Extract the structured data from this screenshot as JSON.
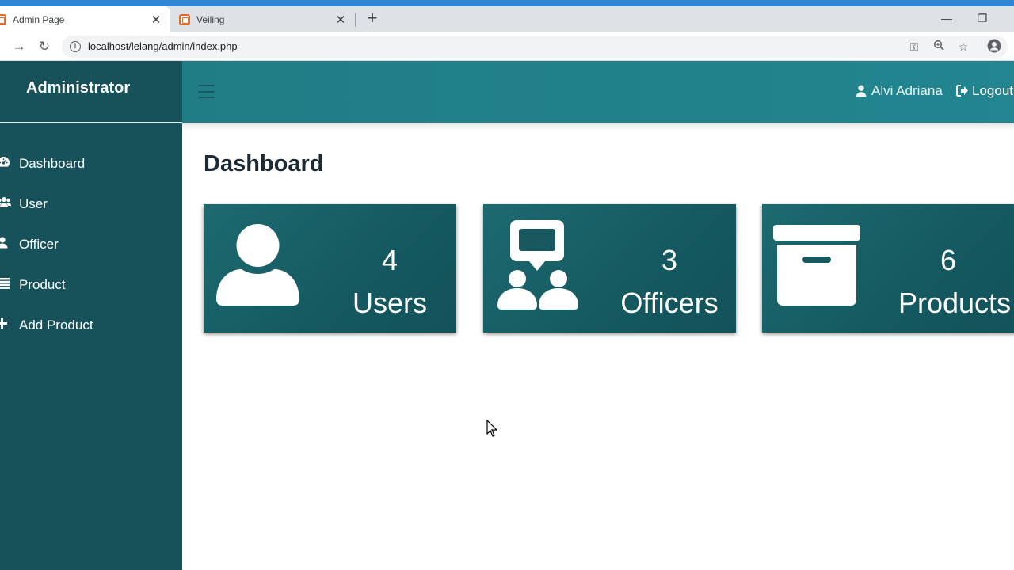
{
  "browser": {
    "tabs": [
      {
        "title": "Admin Page",
        "active": true
      },
      {
        "title": "Veiling",
        "active": false
      }
    ],
    "url": "localhost/lelang/admin/index.php"
  },
  "sidebar": {
    "brand": "Administrator",
    "items": [
      {
        "label": "Dashboard",
        "icon": "dashboard-icon"
      },
      {
        "label": "User",
        "icon": "users-icon"
      },
      {
        "label": "Officer",
        "icon": "user-icon"
      },
      {
        "label": "Product",
        "icon": "list-icon"
      },
      {
        "label": "Add Product",
        "icon": "plus-icon"
      }
    ]
  },
  "topbar": {
    "user_name": "Alvi Adriana",
    "logout_label": "Logout"
  },
  "main": {
    "title": "Dashboard",
    "cards": [
      {
        "count": "4",
        "label": "Users",
        "icon": "user-icon"
      },
      {
        "count": "3",
        "label": "Officers",
        "icon": "officers-chat-icon"
      },
      {
        "count": "6",
        "label": "Products",
        "icon": "archive-box-icon"
      }
    ]
  },
  "colors": {
    "sidebar": "#17525a",
    "topbar": "#207d86",
    "card": "#155960"
  }
}
